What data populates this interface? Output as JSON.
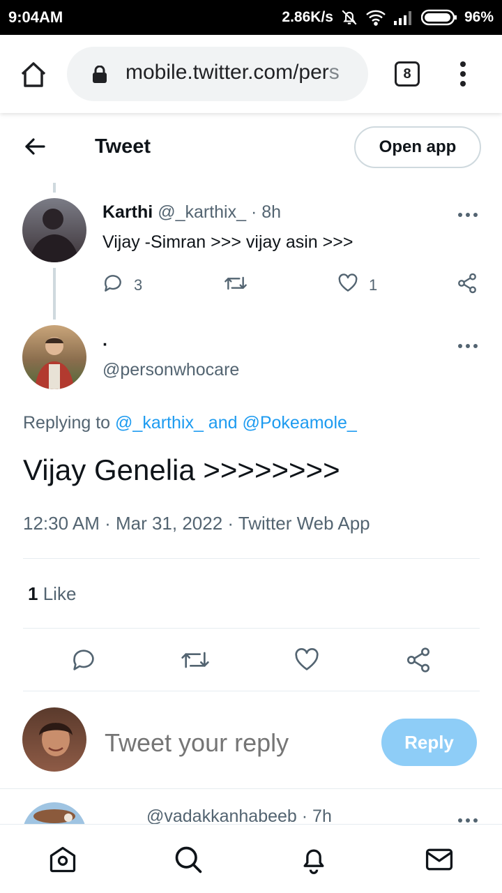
{
  "status_bar": {
    "time": "9:04AM",
    "net_speed": "2.86K/s",
    "battery": "96%"
  },
  "browser": {
    "url_main": "mobile.twitter.com/per",
    "url_fade": "s",
    "tab_count": "8"
  },
  "header": {
    "title": "Tweet",
    "open_app": "Open app"
  },
  "parent_tweet": {
    "name": "Karthi",
    "handle": "@_karthix_ · 8h",
    "text": "Vijay -Simran >>> vijay asin >>>",
    "reply_count": "3",
    "like_count": "1"
  },
  "main_tweet": {
    "name": "·",
    "handle": "@personwhocare",
    "replying_label": "Replying to",
    "replying_users": "@_karthix_ and @Pokeamole_",
    "text": "Vijay Genelia >>>>>>>>",
    "meta": "12:30 AM · Mar 31, 2022 · Twitter Web App",
    "likes_count": "1",
    "likes_label": "Like"
  },
  "compose": {
    "placeholder": "Tweet your reply",
    "reply_label": "Reply"
  },
  "next_tweet": {
    "handle": "@vadakkanhabeeb · 7h"
  },
  "colors": {
    "accent": "#1d9bf0",
    "reply_button": "#8ecdf7",
    "muted": "#536471"
  },
  "icons": [
    "home-icon",
    "lock-icon",
    "more-vert-icon",
    "back-arrow-icon",
    "reply-icon",
    "retweet-icon",
    "like-icon",
    "share-icon",
    "search-icon",
    "bell-icon",
    "mail-icon"
  ]
}
